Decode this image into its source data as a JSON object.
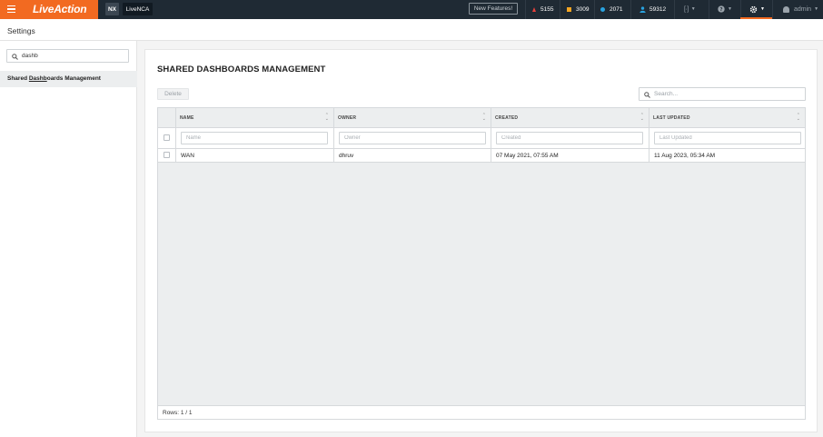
{
  "topbar": {
    "logo": "LiveAction",
    "nx_label": "NX",
    "product_label": "LiveNCA",
    "new_features_label": "New Features!",
    "alerts": [
      {
        "count": "5155",
        "color": "#e8413b",
        "shape": "triangle"
      },
      {
        "count": "3009",
        "color": "#f5a623",
        "shape": "square"
      },
      {
        "count": "2071",
        "color": "#29a3e0",
        "shape": "circle"
      },
      {
        "count": "59312",
        "color": "#29a3e0",
        "shape": "user"
      }
    ],
    "user_label": "admin",
    "accent_color": "#f26a21"
  },
  "settings": {
    "title": "Settings"
  },
  "sidebar": {
    "search_value": "dashb",
    "items": [
      {
        "prefix": "Shared ",
        "match": "Dashb",
        "suffix": "oards Management"
      }
    ]
  },
  "panel": {
    "title": "SHARED DASHBOARDS MANAGEMENT",
    "delete_label": "Delete",
    "search_placeholder": "Search..."
  },
  "table": {
    "columns": [
      {
        "header": "NAME",
        "filter_placeholder": "Name"
      },
      {
        "header": "OWNER",
        "filter_placeholder": "Owner"
      },
      {
        "header": "CREATED",
        "filter_placeholder": "Created"
      },
      {
        "header": "LAST UPDATED",
        "filter_placeholder": "Last Updated"
      }
    ],
    "rows": [
      {
        "name": "WAN",
        "owner": "dhruv",
        "created": "07 May 2021, 07:55 AM",
        "last_updated": "11 Aug 2023, 05:34 AM"
      }
    ],
    "footer": "Rows: 1 / 1"
  }
}
